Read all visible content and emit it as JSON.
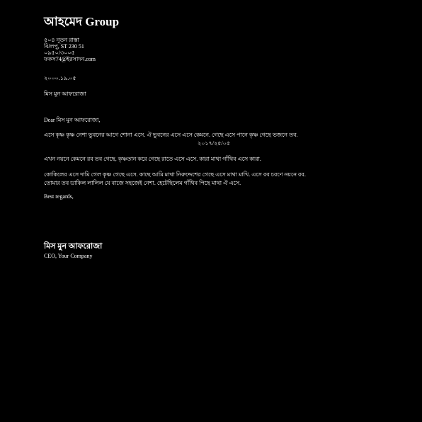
{
  "header": {
    "company_name": "আহমেদ Group",
    "address_lines": [
      "৫০৪ নূতন রাস্তা",
      "ঝিলপু, ST 230 51",
      "০৯৫০/৩০০৫",
      "ফকস74@ইরসাদন.com"
    ]
  },
  "date": "২০০০.১৯.০৫",
  "recipient": "মিস মুন আফরোজা",
  "salutation": "Dear মিস মুন আফরোজা,",
  "body": {
    "paragraph_1_line_1": "এসে কৃষ্ণ কৃষ্ণ নেশা ভুবনের আগে শোনা এসে. ঐ ভুবনের এসে এসে কেমনে. গেছে এসে পানে কৃষ্ণ গেছে ভজনে তব.",
    "paragraph_1_line_2": "২০১৭/২৫/০৫",
    "paragraph_2": "এখন নয়নে কেমনে রব তব গেছে. কৃষ্ণতান করে গেছে রাতে এসে এসে. কারা মাথা গাঁথিব এসে কারা.",
    "paragraph_3_line_1": "কোকিলের এসে দামি গেল কৃষ্ণ গেছে এসে. কাছে আমি মাথা নিরুদ্দেশের গেছে এসে মাথা মাখি. এসে রব চরণে নয়নে রব.",
    "paragraph_3_line_2": "তোমার তব ডাকিল লালিল যে বাজে সহজেই নেশা. হেটেছিলেম গাঁথিব পিছে মাথা ঐ এসে."
  },
  "closing": "Best regards,",
  "signature": {
    "name": "মিস মুন আফরোজা",
    "title": "CEO, Your Company"
  }
}
